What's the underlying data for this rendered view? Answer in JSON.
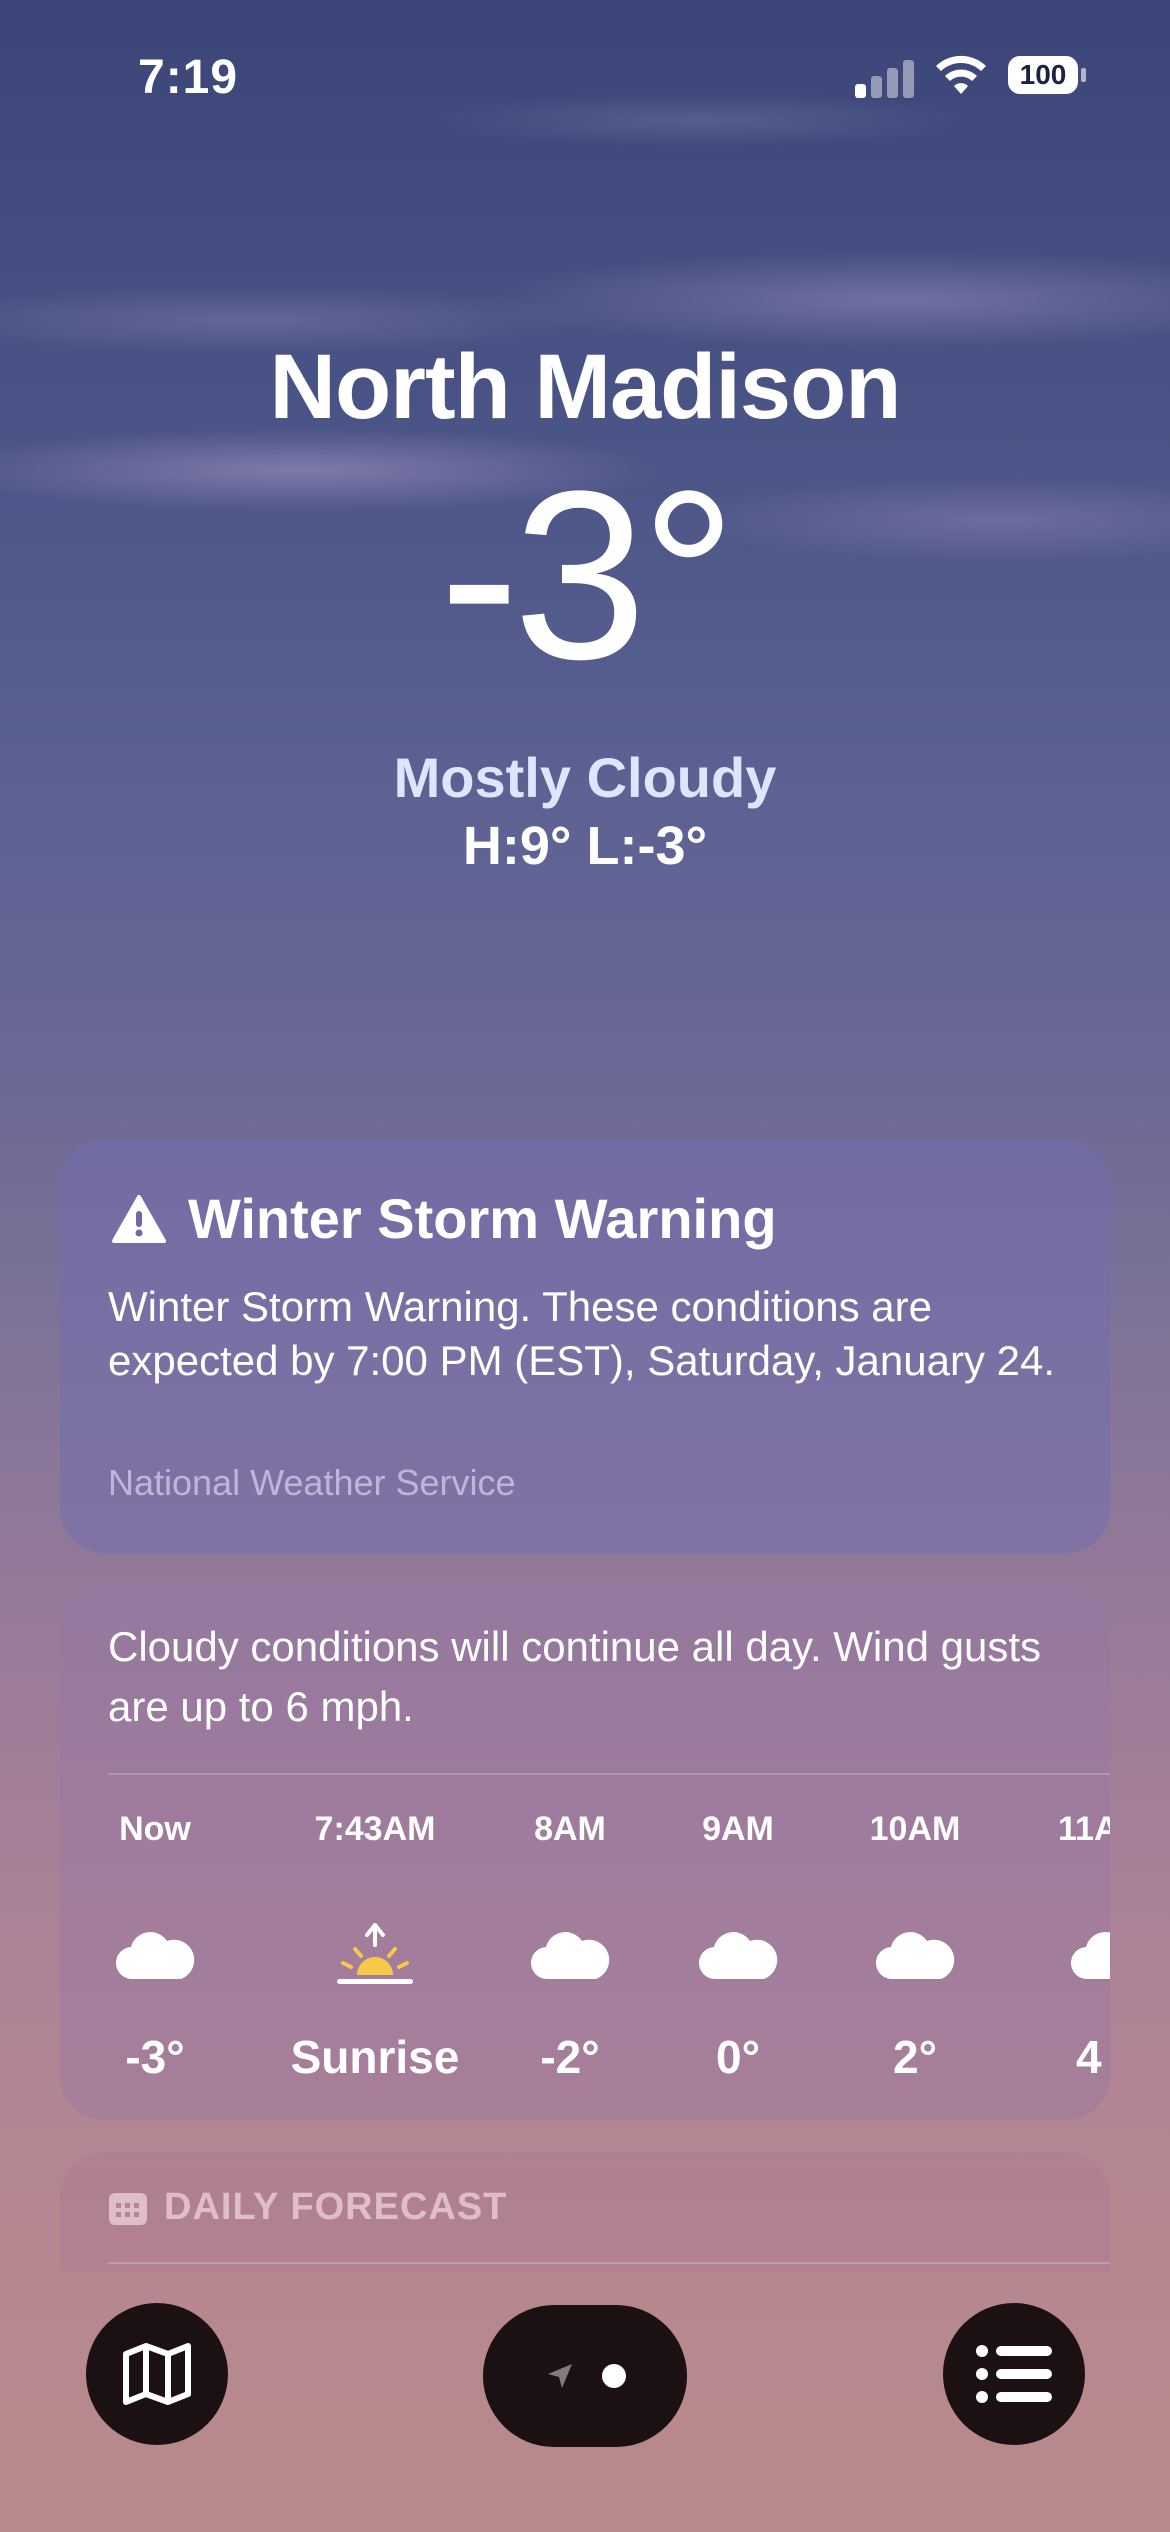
{
  "status_bar": {
    "time": "7:19",
    "battery": "100"
  },
  "location": {
    "city": "North Madison",
    "temperature": "-3°",
    "condition": "Mostly Cloudy",
    "high_low": "H:9°  L:-3°"
  },
  "alert": {
    "title": "Winter Storm Warning",
    "text": "Winter Storm Warning. These conditions are expected by 7:00 PM (EST), Saturday, January 24.",
    "source": "National Weather Service"
  },
  "hourly": {
    "summary": "Cloudy conditions will continue all day. Wind gusts are up to 6 mph.",
    "hours": [
      {
        "label": "Now",
        "icon": "cloud-icon",
        "value": "-3°"
      },
      {
        "label": "7:43AM",
        "icon": "sunrise-icon",
        "value": "Sunrise"
      },
      {
        "label": "8AM",
        "icon": "cloud-icon",
        "value": "-2°"
      },
      {
        "label": "9AM",
        "icon": "cloud-icon",
        "value": "0°"
      },
      {
        "label": "10AM",
        "icon": "cloud-icon",
        "value": "2°"
      },
      {
        "label": "11A",
        "icon": "cloud-icon",
        "value": "4"
      }
    ]
  },
  "daily": {
    "header": "DAILY FORECAST"
  },
  "colors": {
    "sunrise": "#f6c94a",
    "button_bg": "#1b1012"
  }
}
